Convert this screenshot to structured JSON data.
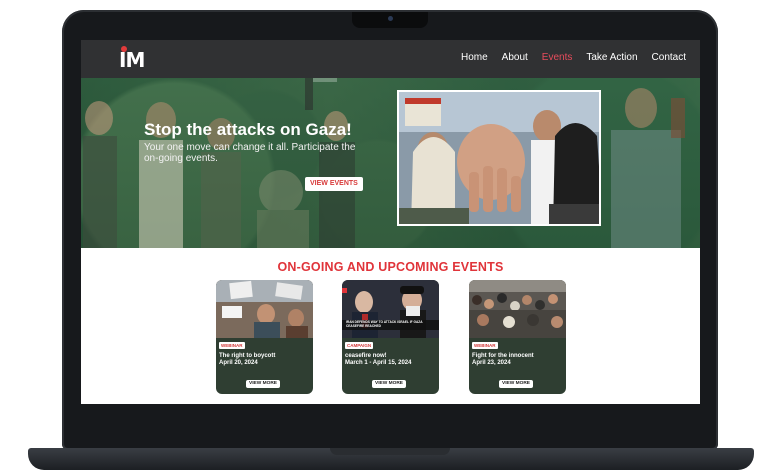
{
  "brand": {
    "logo_text": "M",
    "logo_prefix": "I"
  },
  "nav": {
    "items": [
      {
        "label": "Home",
        "active": false
      },
      {
        "label": "About",
        "active": false
      },
      {
        "label": "Events",
        "active": true
      },
      {
        "label": "Take Action",
        "active": false
      },
      {
        "label": "Contact",
        "active": false
      }
    ]
  },
  "hero": {
    "title": "Stop the attacks on Gaza!",
    "subtitle": "Your one move can change it all. Participate the on-going events.",
    "button_label": "VIEW EVENTS"
  },
  "events": {
    "heading": "ON-GOING AND UPCOMING EVENTS",
    "cards": [
      {
        "badge": "WEBINAR",
        "title": "The right to boycott",
        "date": "April 20, 2024",
        "button": "VIEW MORE"
      },
      {
        "badge": "CAMPAIGN",
        "title": "ceasefire now!",
        "date": "March 1 - April 15, 2024",
        "button": "VIEW MORE",
        "image_caption": "IRAN DEFENDS WAY TO ATTACK ISRAEL IF GAZA CEASEFIRE REACHED"
      },
      {
        "badge": "WEBINAR",
        "title": "Fight for the innocent",
        "date": "April 23, 2024",
        "button": "VIEW MORE"
      }
    ]
  },
  "colors": {
    "accent_red": "#e0343a",
    "nav_active": "#e74c5c",
    "card_bg": "#2f3e32",
    "hero_overlay": "#226840"
  }
}
